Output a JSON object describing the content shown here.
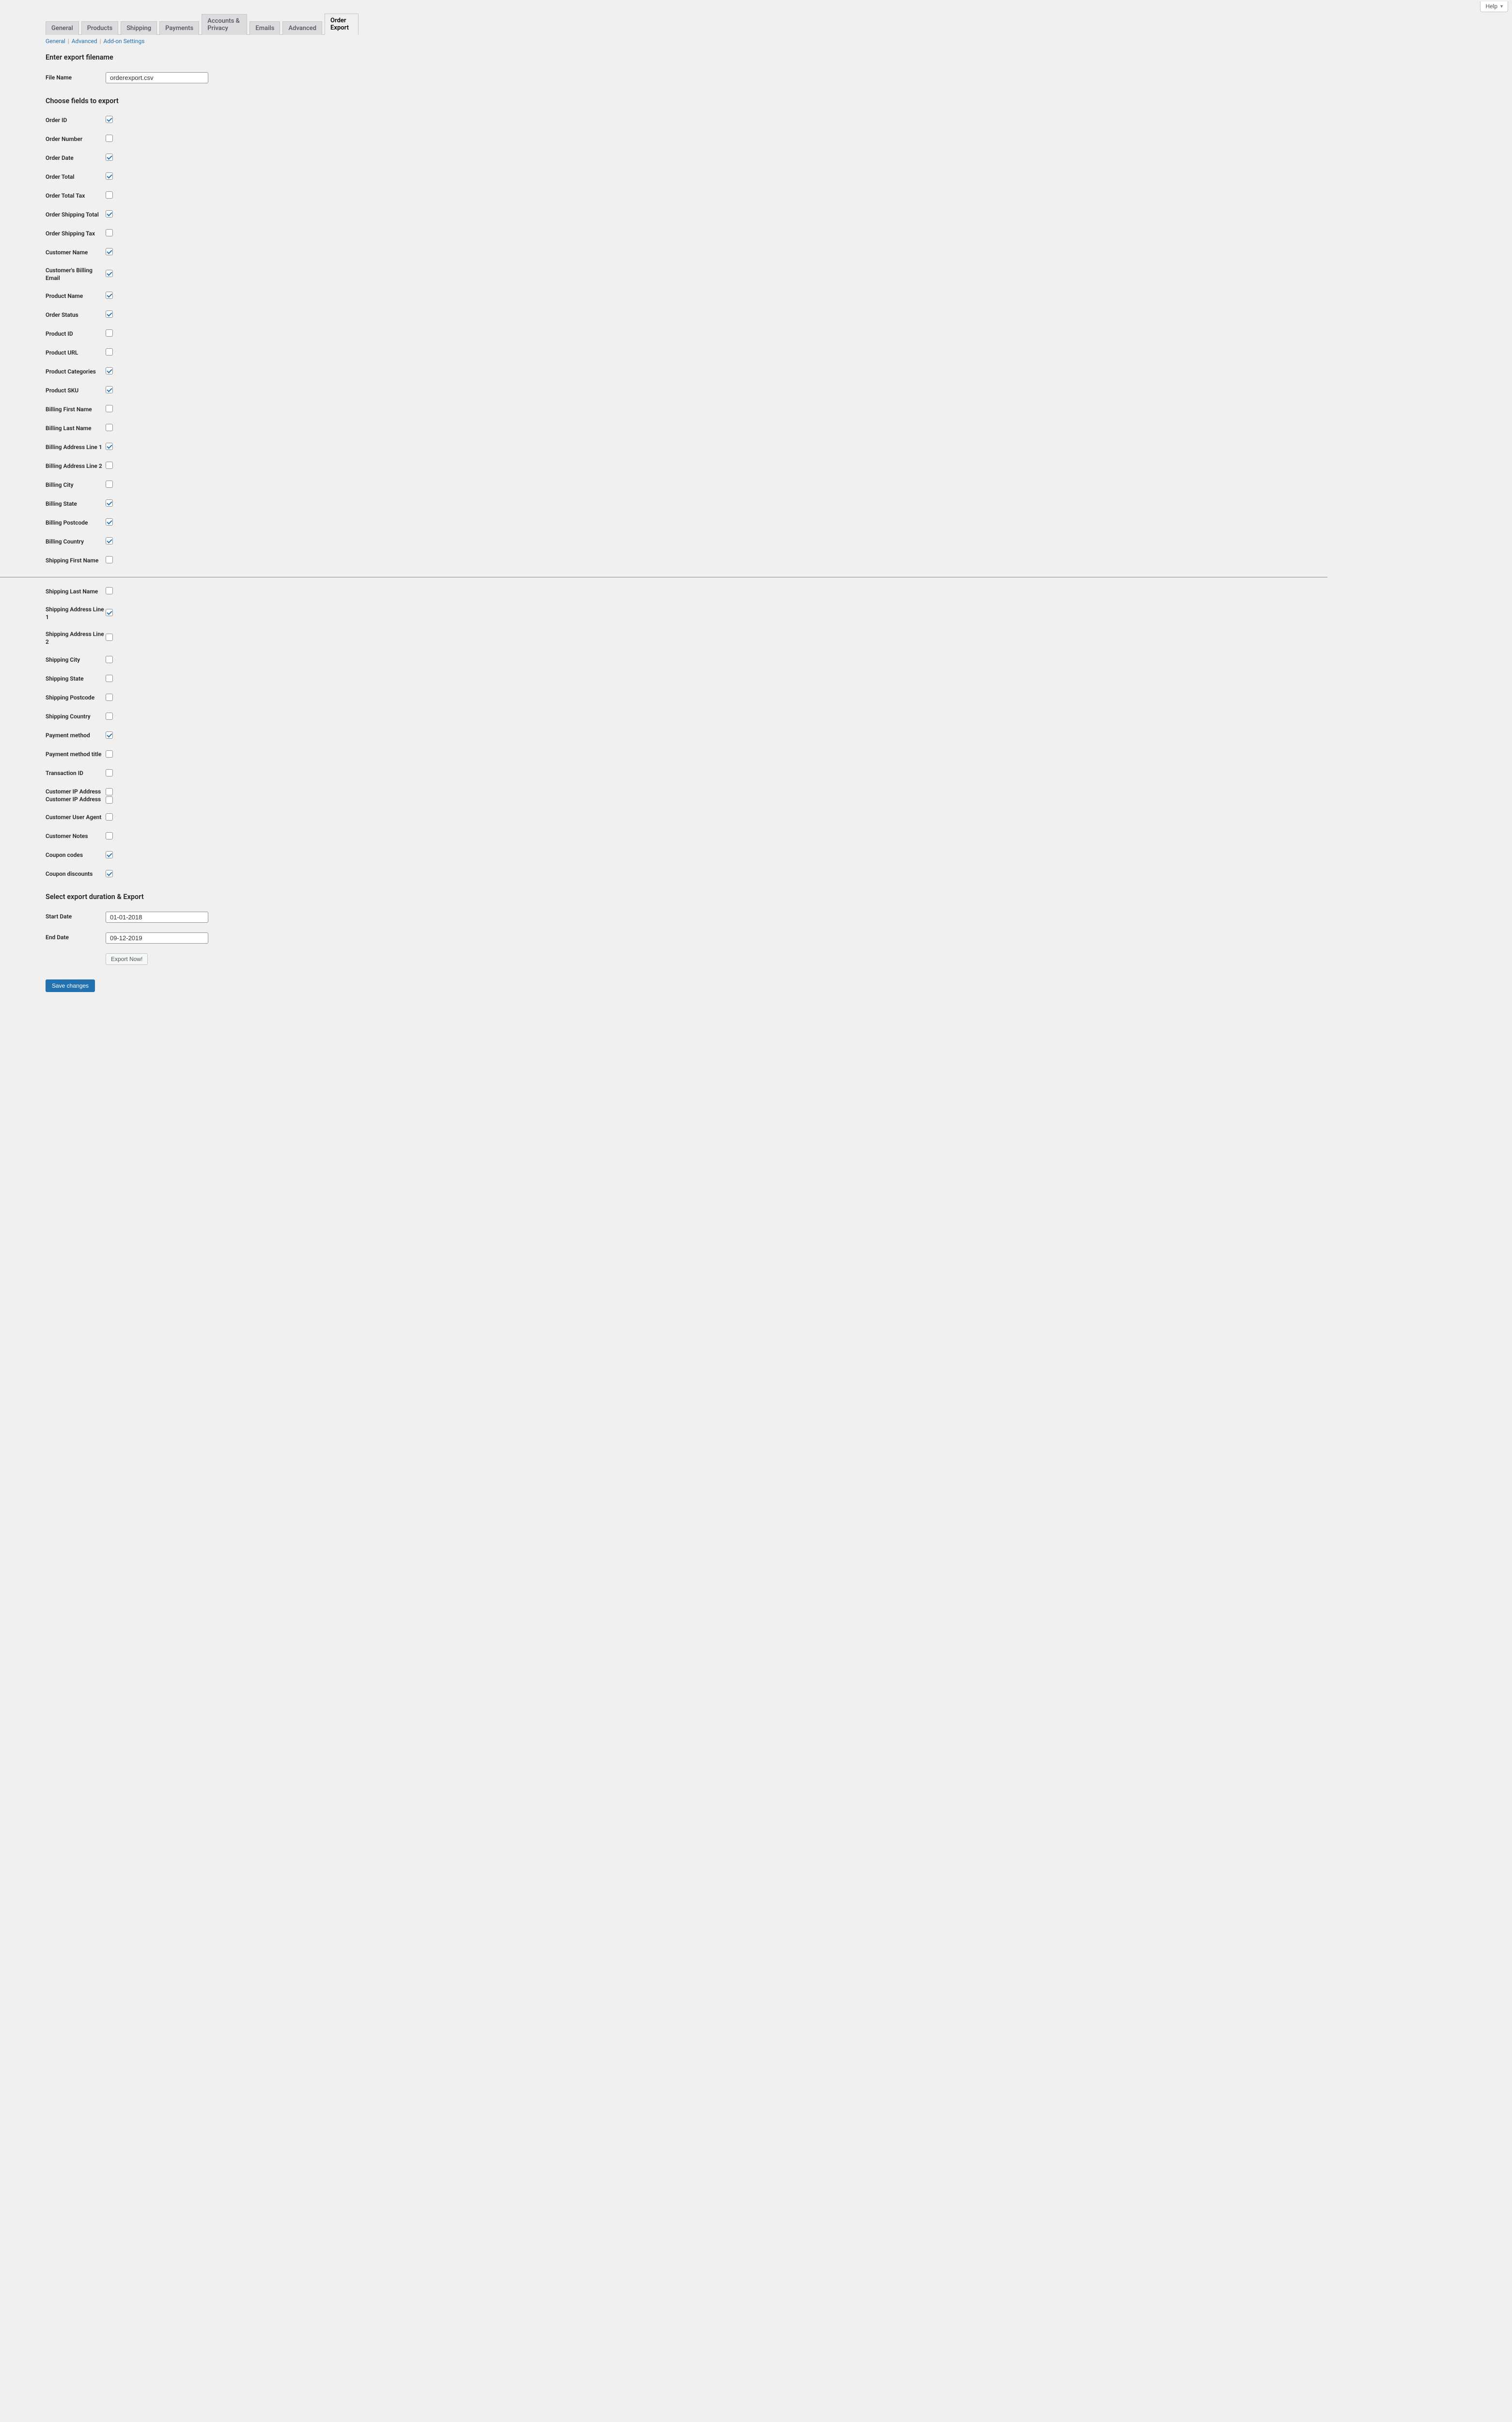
{
  "help": {
    "label": "Help"
  },
  "tabs": [
    {
      "label": "General"
    },
    {
      "label": "Products"
    },
    {
      "label": "Shipping"
    },
    {
      "label": "Payments"
    },
    {
      "label": "Accounts & Privacy"
    },
    {
      "label": "Emails"
    },
    {
      "label": "Advanced"
    },
    {
      "label": "Order Export"
    }
  ],
  "subnav": {
    "general": "General",
    "advanced": "Advanced",
    "addon": "Add-on Settings"
  },
  "headings": {
    "filename": "Enter export filename",
    "fields": "Choose fields to export",
    "duration": "Select export duration & Export"
  },
  "filename": {
    "label": "File Name",
    "value": "orderexport.csv"
  },
  "fields": [
    {
      "label": "Order ID",
      "checked": true
    },
    {
      "label": "Order Number",
      "checked": false
    },
    {
      "label": "Order Date",
      "checked": true
    },
    {
      "label": "Order Total",
      "checked": true
    },
    {
      "label": "Order Total Tax",
      "checked": false
    },
    {
      "label": "Order Shipping Total",
      "checked": true
    },
    {
      "label": "Order Shipping Tax",
      "checked": false
    },
    {
      "label": "Customer Name",
      "checked": true
    },
    {
      "label": "Customer's Billing Email",
      "checked": true
    },
    {
      "label": "Product Name",
      "checked": true
    },
    {
      "label": "Order Status",
      "checked": true
    },
    {
      "label": "Product ID",
      "checked": false
    },
    {
      "label": "Product URL",
      "checked": false
    },
    {
      "label": "Product Categories",
      "checked": true
    },
    {
      "label": "Product SKU",
      "checked": true
    },
    {
      "label": "Billing First Name",
      "checked": false
    },
    {
      "label": "Billing Last Name",
      "checked": false
    },
    {
      "label": "Billing Address Line 1",
      "checked": true
    },
    {
      "label": "Billing Address Line 2",
      "checked": false
    },
    {
      "label": "Billing City",
      "checked": false
    },
    {
      "label": "Billing State",
      "checked": true
    },
    {
      "label": "Billing Postcode",
      "checked": true
    },
    {
      "label": "Billing Country",
      "checked": true
    },
    {
      "label": "Shipping First Name",
      "checked": false
    },
    {
      "label": "Shipping Last Name",
      "checked": false
    },
    {
      "label": "Shipping Address Line 1",
      "checked": true
    },
    {
      "label": "Shipping Address Line 2",
      "checked": false
    },
    {
      "label": "Shipping City",
      "checked": false
    },
    {
      "label": "Shipping State",
      "checked": false
    },
    {
      "label": "Shipping Postcode",
      "checked": false
    },
    {
      "label": "Shipping Country",
      "checked": false
    },
    {
      "label": "Payment method",
      "checked": true
    },
    {
      "label": "Payment method title",
      "checked": false
    },
    {
      "label": "Transaction ID",
      "checked": false
    },
    {
      "label": "Customer IP Address\nCustomer IP Address",
      "checked": false,
      "double": true
    },
    {
      "label": "Customer User Agent",
      "checked": false
    },
    {
      "label": "Customer Notes",
      "checked": false
    },
    {
      "label": "Coupon codes",
      "checked": true
    },
    {
      "label": "Coupon discounts",
      "checked": true
    }
  ],
  "divider_after_index": 23,
  "startDate": {
    "label": "Start Date",
    "value": "01-01-2018"
  },
  "endDate": {
    "label": "End Date",
    "value": "09-12-2019"
  },
  "buttons": {
    "export": "Export Now!",
    "save": "Save changes"
  }
}
